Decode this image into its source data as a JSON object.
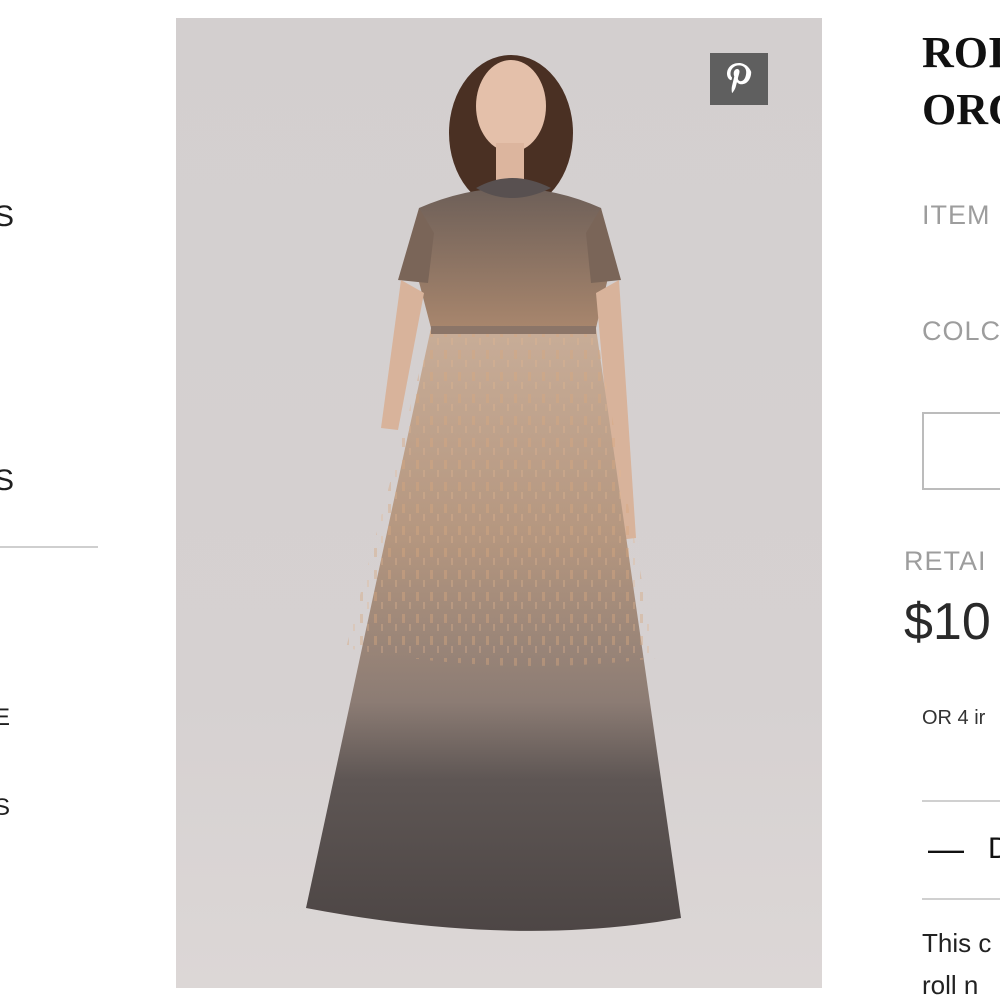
{
  "left_nav": {
    "items": [
      {
        "label": "S"
      },
      {
        "label": "S"
      },
      {
        "label": "E"
      },
      {
        "label": "S"
      }
    ]
  },
  "product": {
    "pin_icon": "pinterest-icon",
    "title_line1": "ROI",
    "title_line2": "ORC",
    "item_label": "ITEM",
    "color_label": "COLC",
    "retail_label": "RETAI",
    "price": "$10",
    "installments": "OR 4 ir",
    "description_toggle": "—",
    "description_heading": "D",
    "description_line1": "This c",
    "description_line2": "roll n"
  },
  "colors": {
    "accent": "#5f5f5f",
    "label_gray": "#9d9d9d"
  }
}
